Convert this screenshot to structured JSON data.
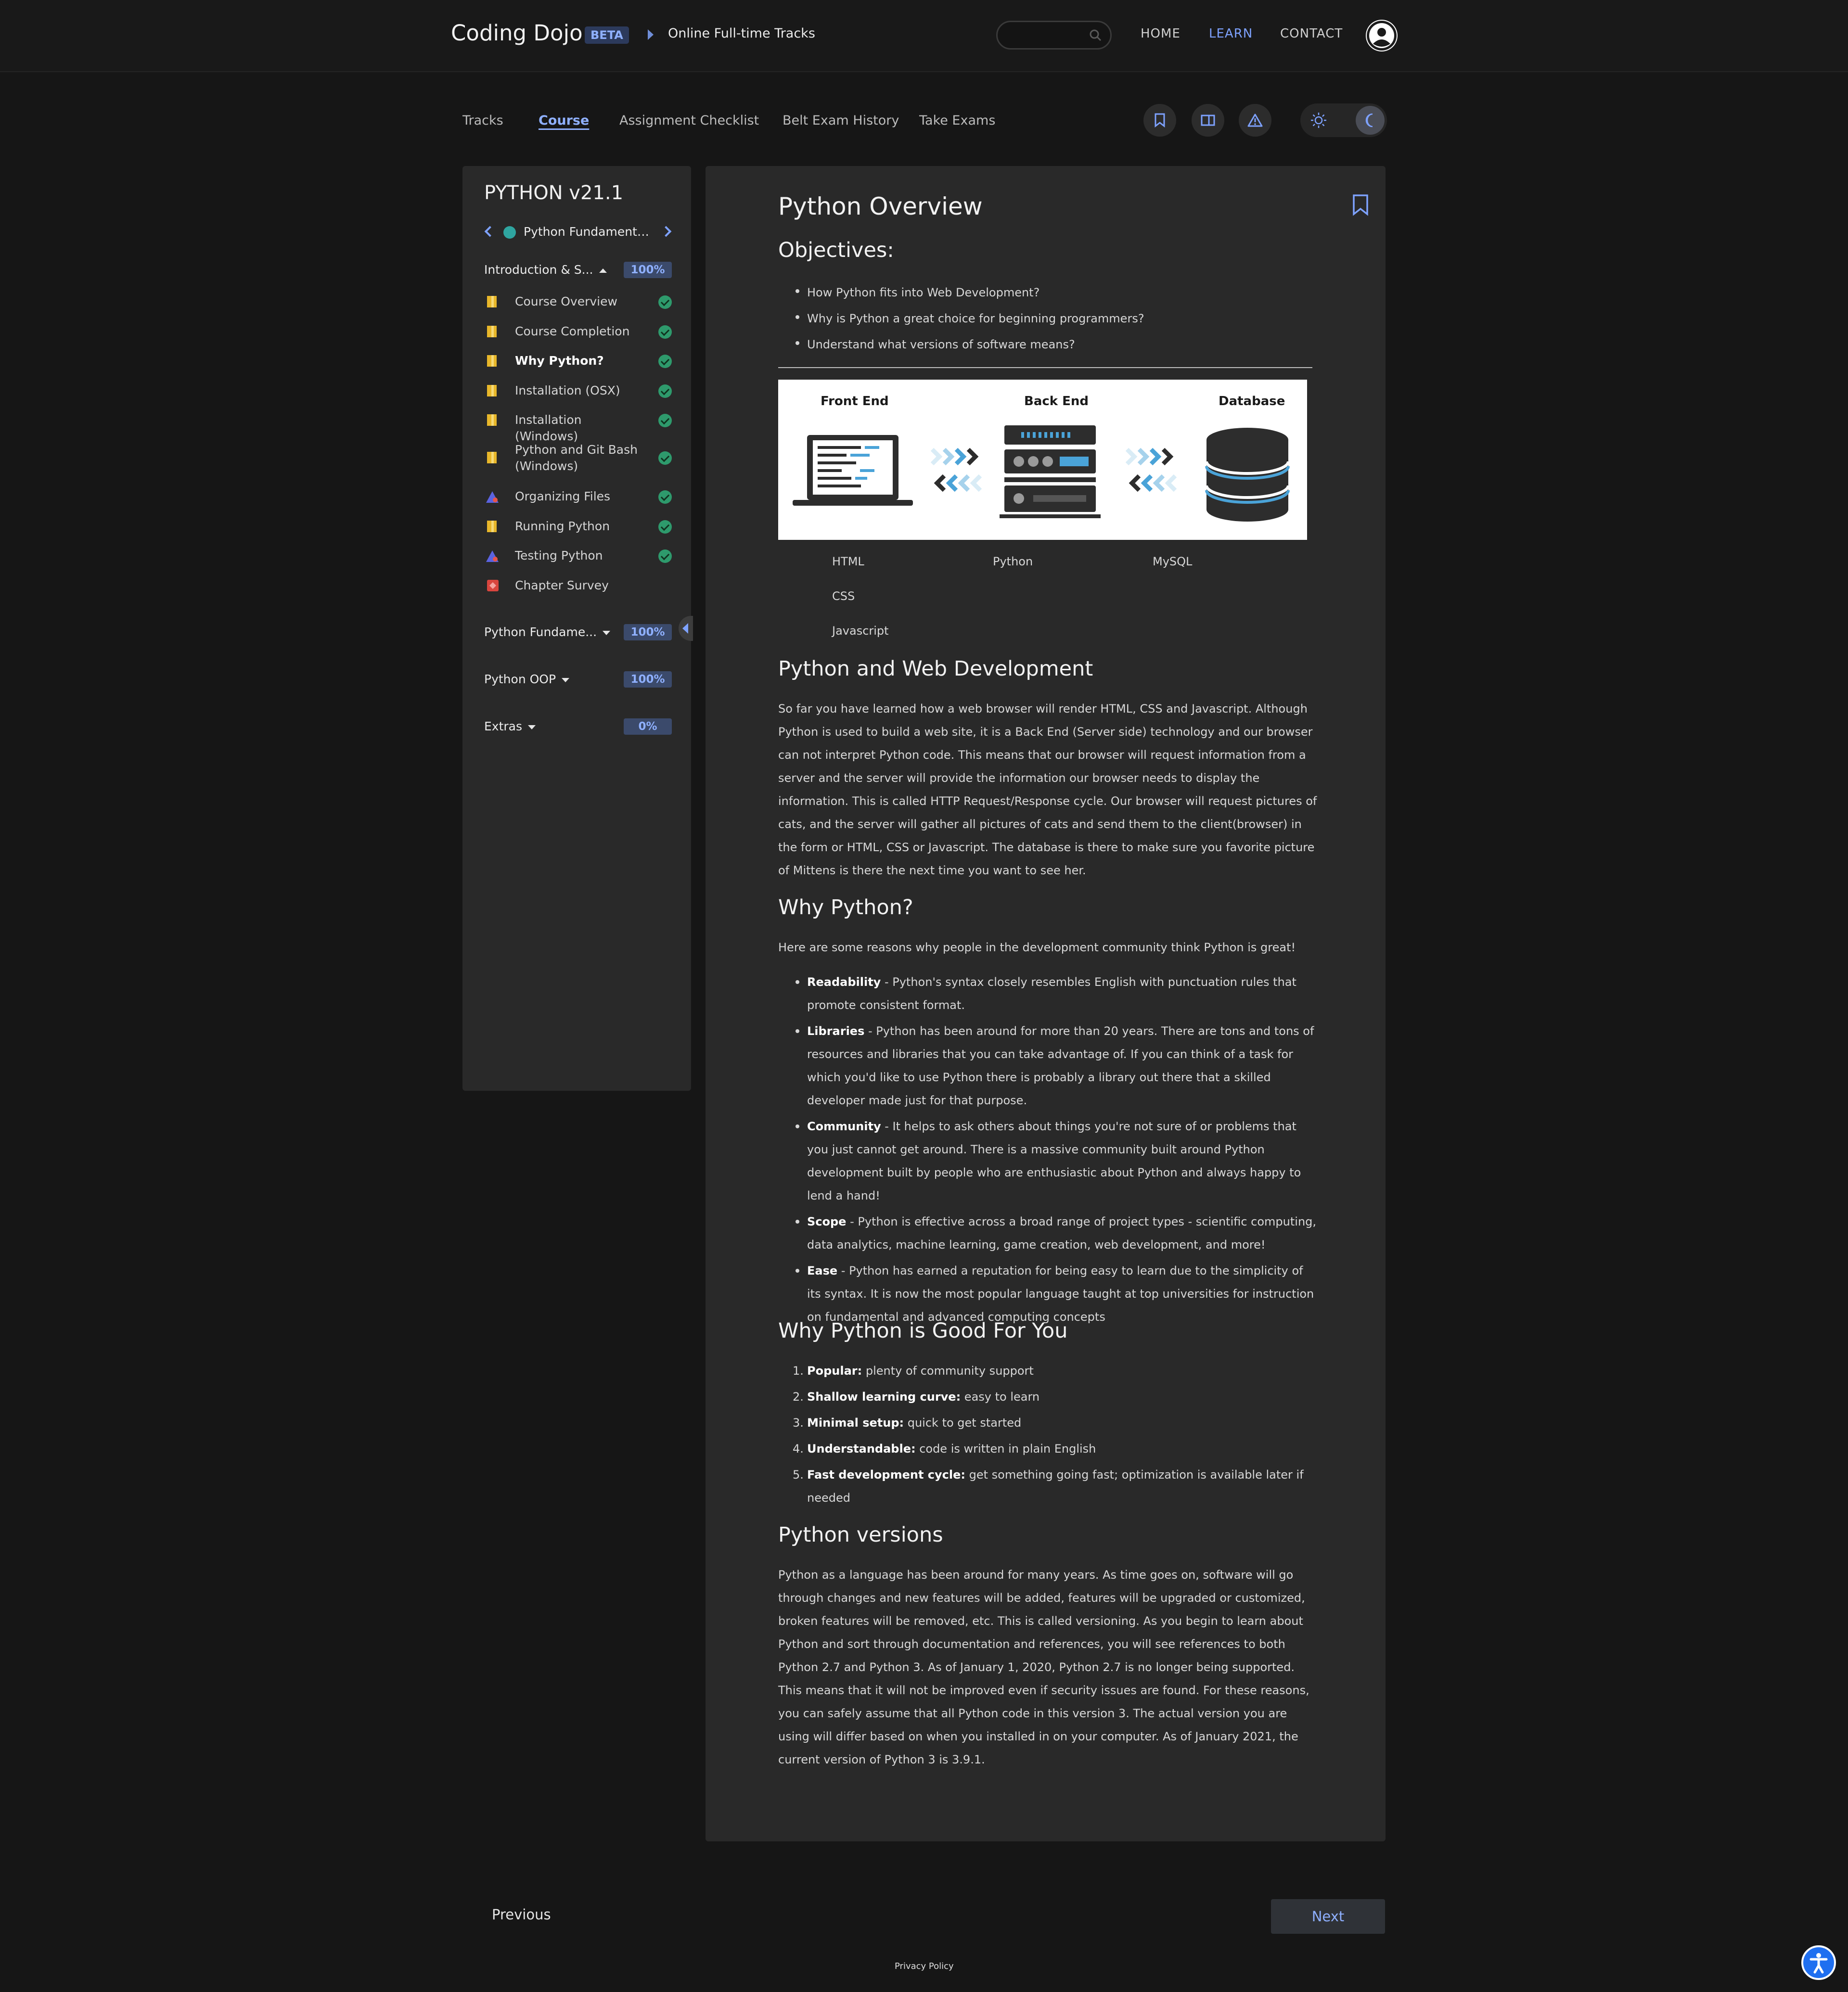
{
  "header": {
    "brand": "Coding Dojo",
    "beta": "BETA",
    "breadcrumb": "Online Full-time Tracks",
    "nav": [
      "HOME",
      "LEARN",
      "CONTACT"
    ],
    "active_nav": "LEARN",
    "search_placeholder": ""
  },
  "subnav": {
    "tabs": [
      "Tracks",
      "Course",
      "Assignment Checklist",
      "Belt Exam History",
      "Take Exams"
    ],
    "active": "Course"
  },
  "sidebar": {
    "course_title": "PYTHON v21.1",
    "chapter": "Python Fundamentals",
    "sections": [
      {
        "label": "Introduction & S...",
        "percent": "100%",
        "expanded": true
      },
      {
        "label": "Python Fundame...",
        "percent": "100%",
        "expanded": false
      },
      {
        "label": "Python OOP",
        "percent": "100%",
        "expanded": false
      },
      {
        "label": "Extras",
        "percent": "0%",
        "expanded": false
      }
    ],
    "lessons": [
      {
        "label": "Course Overview",
        "icon": "book-icon",
        "done": true
      },
      {
        "label": "Course Completion",
        "icon": "book-icon",
        "done": true
      },
      {
        "label": "Why Python?",
        "icon": "book-icon",
        "done": true,
        "current": true
      },
      {
        "label": "Installation (OSX)",
        "icon": "book-icon",
        "done": true
      },
      {
        "label": "Installation (Windows)",
        "icon": "book-icon",
        "done": true
      },
      {
        "label": "Python and Git Bash (Windows)",
        "icon": "book-icon",
        "done": true
      },
      {
        "label": "Organizing Files",
        "icon": "assignment-icon",
        "done": true
      },
      {
        "label": "Running Python",
        "icon": "book-icon",
        "done": true
      },
      {
        "label": "Testing Python",
        "icon": "assignment-icon",
        "done": true
      },
      {
        "label": "Chapter Survey",
        "icon": "survey-icon",
        "done": false
      }
    ]
  },
  "content": {
    "title": "Python Overview",
    "objectives_heading": "Objectives:",
    "objectives": [
      "How Python fits into Web Development?",
      "Why is Python a great choice for beginning programmers?",
      "Understand what versions of software means?"
    ],
    "diagram": {
      "front_end": "Front End",
      "back_end": "Back End",
      "database": "Database"
    },
    "tech": {
      "html": "HTML",
      "css": "CSS",
      "javascript": "Javascript",
      "python": "Python",
      "mysql": "MySQL"
    },
    "webdev_heading": "Python and Web Development",
    "webdev_text": "So far you have learned how a web browser will render HTML, CSS and Javascript.  Although Python is used to build a web site, it is a Back End (Server side) technology and our browser can not interpret Python code.  This means that our browser will request information from a server and the server will provide the information our browser needs to display the information.  This is called HTTP Request/Response cycle.  Our browser will request pictures of cats, and the server will gather all pictures of cats and send them to the client(browser) in the form or HTML, CSS or Javascript.  The database is there to make sure you favorite picture of Mittens is there the next time you want to see her.",
    "why_heading": "Why Python?",
    "why_intro": "Here are some reasons why people in the development community think Python is great!",
    "reasons": [
      {
        "term": "Readability",
        "text": " - Python's syntax closely resembles English with punctuation rules that promote consistent format."
      },
      {
        "term": "Libraries",
        "text": " - Python has been around for more than 20 years. There are tons and tons of resources and libraries that you can take advantage of. If you can think of a task for which you'd like to use Python there is probably a library out there that a skilled developer made just for that purpose."
      },
      {
        "term": "Community",
        "text": " - It helps to ask others about things you're not sure of or problems that you just cannot get around. There is a massive community built around Python development built by people who are enthusiastic about Python and always happy to lend a hand!"
      },
      {
        "term": "Scope",
        "text": " - Python is effective across a broad range of project types - scientific computing, data analytics, machine learning, game creation, web development, and more!"
      },
      {
        "term": "Ease",
        "text": " - Python has earned a reputation for being easy to learn due to the simplicity of its syntax. It is now the most popular language taught at top universities for instruction on fundamental and advanced computing concepts"
      }
    ],
    "good_heading": "Why Python is Good For You",
    "good_items": [
      {
        "n": "1.",
        "term": "Popular:",
        "text": " plenty of community support"
      },
      {
        "n": "2.",
        "term": "Shallow learning curve:",
        "text": " easy to learn"
      },
      {
        "n": "3.",
        "term": "Minimal setup:",
        "text": " quick to get started"
      },
      {
        "n": "4.",
        "term": "Understandable:",
        "text": " code is written in plain English"
      },
      {
        "n": "5.",
        "term": "Fast development cycle:",
        "text": " get something going fast; optimization is available later if needed"
      }
    ],
    "versions_heading": "Python versions",
    "versions_text": "Python as a language has been around for many years.  As time goes on, software will go through changes and new features will be added, features will be upgraded or customized, broken features will be removed, etc.  This is called versioning.  As you begin to learn about Python and sort through documentation and references, you will see references to both Python 2.7 and Python 3.  As of January 1, 2020, Python 2.7 is no longer being supported.  This means that it will not be improved even if security issues are found.  For these reasons, you can safely assume that all Python code in this version 3.  The actual version you are using will differ based on when you installed in on your computer.  As of January 2021, the current version of Python 3 is 3.9.1."
  },
  "footer": {
    "previous": "Previous",
    "next": "Next",
    "privacy": "Privacy Policy"
  },
  "colors": {
    "accent": "#7ea2ff",
    "background": "#161616",
    "panel": "#292929",
    "done": "#2e9a6c"
  }
}
